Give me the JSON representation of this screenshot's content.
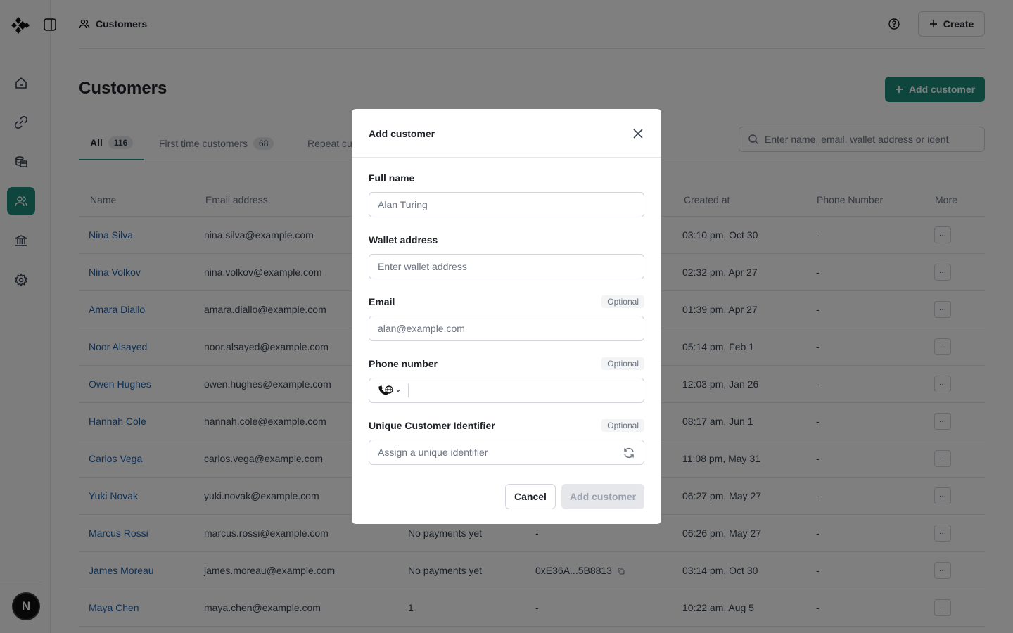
{
  "breadcrumb": {
    "label": "Customers"
  },
  "topbar": {
    "create_label": "Create"
  },
  "page": {
    "title": "Customers",
    "add_customer_label": "Add customer"
  },
  "tabs": [
    {
      "label": "All",
      "count": "116"
    },
    {
      "label": "First time customers",
      "count": "68"
    },
    {
      "label": "Repeat cu"
    }
  ],
  "search": {
    "placeholder": "Enter name, email, wallet address or ident"
  },
  "table": {
    "headers": {
      "name": "Name",
      "email": "Email address",
      "created": "Created at",
      "phone": "Phone Number",
      "more": "More"
    },
    "rows": [
      {
        "name": "Nina Silva",
        "email": "nina.silva@example.com",
        "created": "03:10 pm, Oct 30",
        "phone": "-"
      },
      {
        "name": "Nina Volkov",
        "email": "nina.volkov@example.com",
        "created": "02:32 pm, Apr 27",
        "phone": "-"
      },
      {
        "name": "Amara Diallo",
        "email": "amara.diallo@example.com",
        "created": "01:39 pm, Apr 27",
        "phone": "-"
      },
      {
        "name": "Noor Alsayed",
        "email": "noor.alsayed@example.com",
        "created": "05:14 pm, Feb 1",
        "phone": "-"
      },
      {
        "name": "Owen Hughes",
        "email": "owen.hughes@example.com",
        "created": "12:03 pm, Jan 26",
        "phone": "-"
      },
      {
        "name": "Hannah Cole",
        "email": "hannah.cole@example.com",
        "created": "08:17 am, Jun 1",
        "phone": "-"
      },
      {
        "name": "Carlos Vega",
        "email": "carlos.vega@example.com",
        "created": "11:08 pm, May 31",
        "phone": "-"
      },
      {
        "name": "Yuki Novak",
        "email": "yuki.novak@example.com",
        "created": "06:27 pm, May 27",
        "phone": "-"
      },
      {
        "name": "Marcus Rossi",
        "email": "marcus.rossi@example.com",
        "payments": "No payments yet",
        "wallet": "-",
        "created": "06:26 pm, May 27",
        "phone": "-"
      },
      {
        "name": "James Moreau",
        "email": "james.moreau@example.com",
        "payments": "No payments yet",
        "wallet": "0xE36A...5B8813",
        "created": "03:14 pm, Oct 30",
        "phone": "-"
      },
      {
        "name": "Maya Chen",
        "email": "maya.chen@example.com",
        "payments": "1",
        "wallet": "-",
        "created": "10:22 am, Aug 5",
        "phone": "-"
      }
    ],
    "more_label": "···"
  },
  "user": {
    "initial": "N"
  },
  "modal": {
    "title": "Add customer",
    "optional_label": "Optional",
    "full_name": {
      "label": "Full name",
      "placeholder": "Alan Turing"
    },
    "wallet": {
      "label": "Wallet address",
      "placeholder": "Enter wallet address"
    },
    "email": {
      "label": "Email",
      "placeholder": "alan@example.com"
    },
    "phone": {
      "label": "Phone number"
    },
    "identifier": {
      "label": "Unique Customer Identifier",
      "placeholder": "Assign a unique identifier"
    },
    "cancel_label": "Cancel",
    "submit_label": "Add customer"
  },
  "colors": {
    "accent": "#1d8a7a",
    "link": "#1d5fa8"
  }
}
